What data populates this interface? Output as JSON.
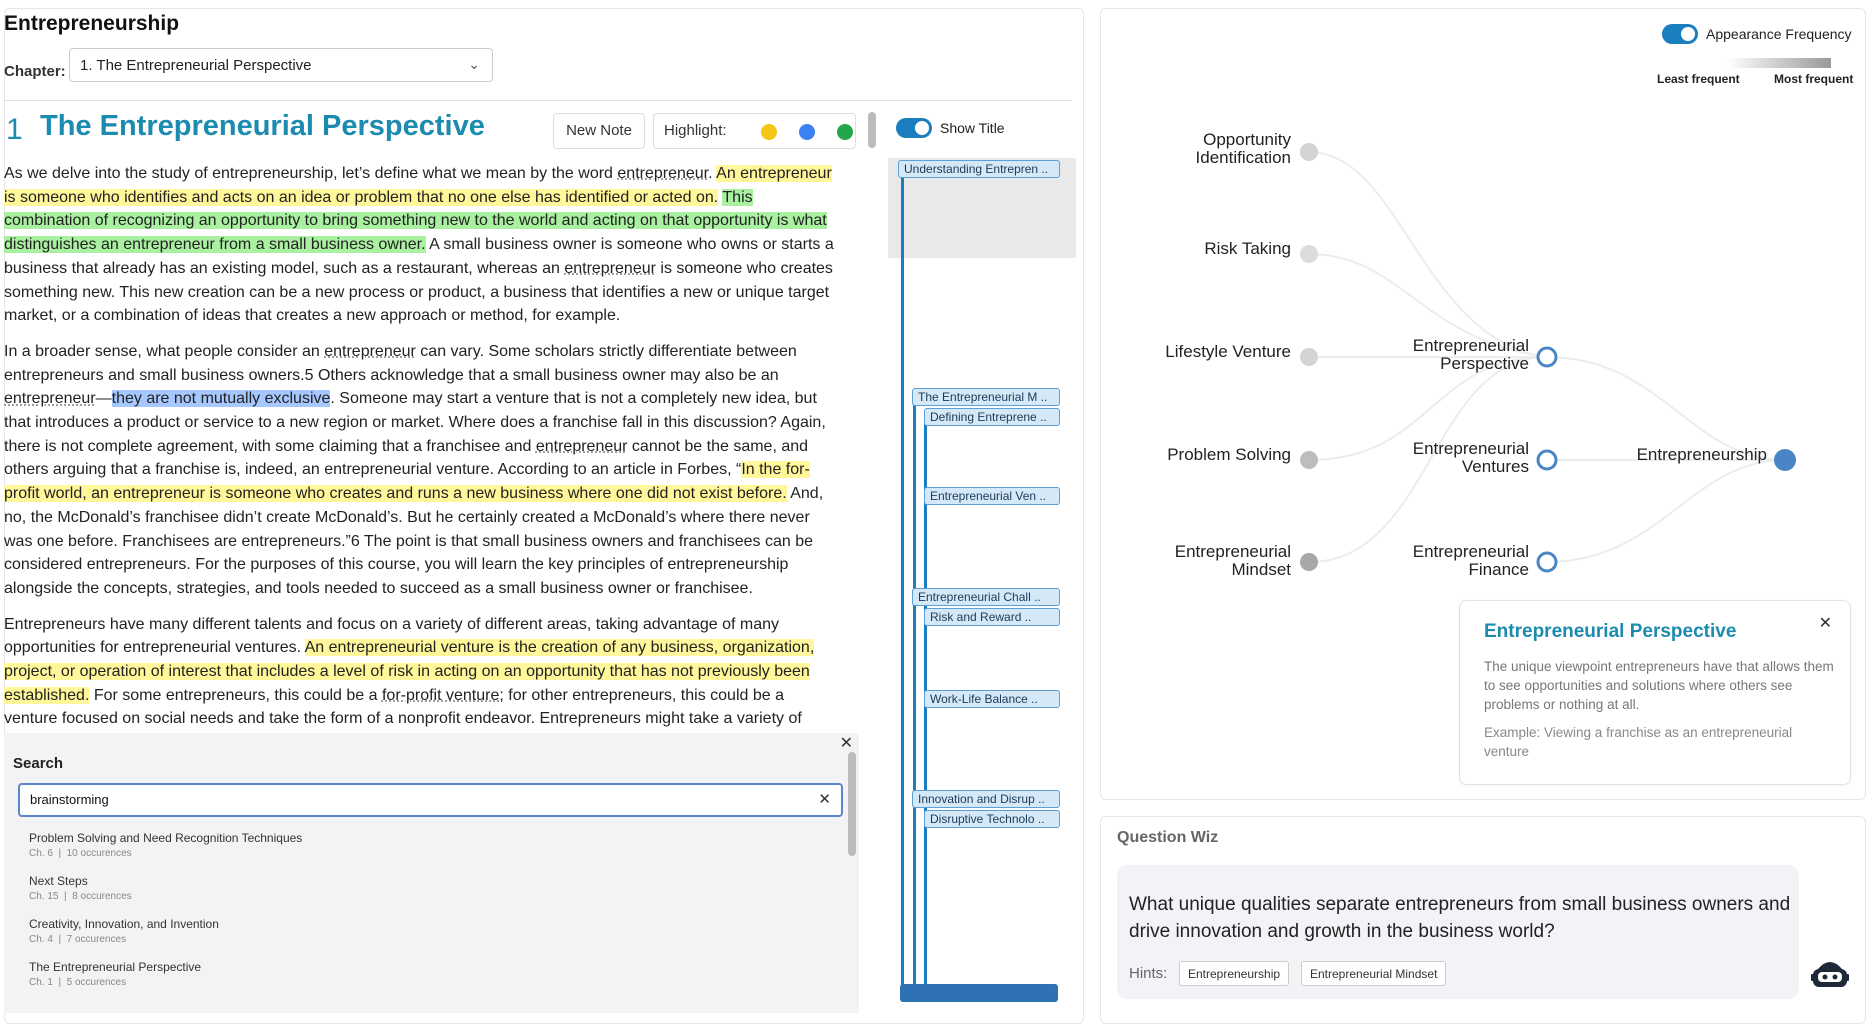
{
  "app": {
    "title": "Entrepreneurship"
  },
  "chapter": {
    "label": "Chapter:",
    "selected": "1. The Entrepreneurial Perspective"
  },
  "section": {
    "number": "1",
    "title": "The Entrepreneurial Perspective"
  },
  "toolbar": {
    "new_note": "New Note",
    "highlight_label": "Highlight:",
    "highlight_colors": [
      "#f5c518",
      "#3b82f6",
      "#22a84a"
    ]
  },
  "text": {
    "p1": [
      {
        "t": "As we delve into the study of entrepreneurship, let’s define what we mean by the word ",
        "c": ""
      },
      {
        "t": "entrepreneur",
        "c": "u"
      },
      {
        "t": ". ",
        "c": ""
      },
      {
        "t": "An ",
        "c": "y"
      },
      {
        "t": "entrepreneur is someone who identifies and acts on an idea or problem that no one else has identified or acted on.",
        "c": "y"
      },
      {
        "t": " ",
        "c": ""
      },
      {
        "t": "This combination of recognizing an opportunity to bring something new to the world and acting on that opportunity is what distinguishes an entrepreneur from a small business owner.",
        "c": "g"
      },
      {
        "t": " A small business owner is someone who owns or starts a business that already has an existing model, such as a restaurant, whereas an ",
        "c": ""
      },
      {
        "t": "entrepreneur",
        "c": "u"
      },
      {
        "t": " is someone who creates something new. This new creation can be a new process or product, a business that identifies a new or unique target market, or a combination of ideas that creates a new approach or method, for example.",
        "c": ""
      }
    ],
    "p2": [
      {
        "t": "In a broader sense, what people consider an ",
        "c": ""
      },
      {
        "t": "entrepreneur",
        "c": "u"
      },
      {
        "t": " can vary. Some scholars strictly differentiate between entrepreneurs and small business owners.5 Others acknowledge that a small business owner may also be an ",
        "c": ""
      },
      {
        "t": "entrepreneur",
        "c": "u"
      },
      {
        "t": "—",
        "c": ""
      },
      {
        "t": "they are not mutually exclusive",
        "c": "b"
      },
      {
        "t": ". Someone may start a venture that is not a completely new idea, but that introduces a product or service to a new region or market. Where does a franchise fall in this discussion? Again, there is not complete agreement, with some claiming that a franchisee and ",
        "c": ""
      },
      {
        "t": "entrepreneur",
        "c": "u"
      },
      {
        "t": " cannot be the same, and others arguing that a franchise is, indeed, an entrepreneurial venture. According to an article in Forbes, “",
        "c": ""
      },
      {
        "t": "In the for-profit world, an entrepreneur is someone who creates and runs a new business where one did not exist before.",
        "c": "y"
      },
      {
        "t": " And, no, the McDonald’s franchisee didn’t create McDonald’s. But he certainly created a McDonald’s where there never was one before. Franchisees are entrepreneurs.”6 The point is that small business owners and franchisees can be considered entrepreneurs. For the purposes of this course, you will learn the key principles of entrepreneurship alongside the concepts, strategies, and tools needed to succeed as a small business owner or franchisee.",
        "c": ""
      }
    ],
    "p3": [
      {
        "t": "Entrepreneurs have many different talents and focus on a variety of different areas, taking advantage of many opportunities for entrepreneurial ventures. ",
        "c": ""
      },
      {
        "t": "An entrepreneurial venture is the creation of any business, organization, project, or operation of interest that includes a level of risk in acting on an opportunity that has not previously been established.",
        "c": "y"
      },
      {
        "t": " For some entrepreneurs, this could be a ",
        "c": ""
      },
      {
        "t": "for-profit venture",
        "c": "u"
      },
      {
        "t": "; for other entrepreneurs, this could be a venture focused on social needs and take the form of a nonprofit endeavor. Entrepreneurs might take a variety of approaches to their ventures, from small local businesses to large global organizations.",
        "c": ""
      }
    ]
  },
  "search": {
    "label": "Search",
    "query": "brainstorming",
    "results": [
      {
        "title": "Problem Solving and Need Recognition Techniques",
        "chapter": "Ch. 6",
        "count": "10 occurences"
      },
      {
        "title": "Next Steps",
        "chapter": "Ch. 15",
        "count": "8 occurences"
      },
      {
        "title": "Creativity, Innovation, and Invention",
        "chapter": "Ch. 4",
        "count": "7 occurences"
      },
      {
        "title": "The Entrepreneurial Perspective",
        "chapter": "Ch. 1",
        "count": "5 occurences"
      }
    ]
  },
  "timeline": {
    "show_title_label": "Show Title",
    "items": [
      "Understanding Entrepren ..",
      "The Entrepreneurial M ..",
      "Defining Entreprene ..",
      "Entrepreneurial Ven ..",
      "Entrepreneurial Chall ..",
      "Risk and Reward ..",
      "Work-Life Balance ..",
      "Innovation and Disrup ..",
      "Disruptive Technolo .."
    ]
  },
  "graph": {
    "toggle_label": "Appearance Frequency",
    "legend_least": "Least frequent",
    "legend_most": "Most frequent",
    "nodes": {
      "opportunity": [
        "Opportunity",
        "Identification"
      ],
      "risk": [
        "Risk Taking"
      ],
      "lifestyle": [
        "Lifestyle Venture"
      ],
      "problem": [
        "Problem Solving"
      ],
      "mindset": [
        "Entrepreneurial",
        "Mindset"
      ],
      "perspective": [
        "Entrepreneurial",
        "Perspective"
      ],
      "ventures": [
        "Entrepreneurial",
        "Ventures"
      ],
      "finance": [
        "Entrepreneurial",
        "Finance"
      ],
      "root": [
        "Entrepreneurship"
      ]
    },
    "colors": {
      "accent": "#1b7fbf",
      "root": "#4a86c5",
      "leaf_light": "#d4d4d4",
      "leaf_dark": "#a8a8a8"
    }
  },
  "definition": {
    "title": "Entrepreneurial Perspective",
    "body": "The unique viewpoint entrepreneurs have that allows them to see opportunities and solutions where others see problems or nothing at all.",
    "example": "Example: Viewing a franchise as an entrepreneurial venture"
  },
  "question_wiz": {
    "title": "Question Wiz",
    "question": "What unique qualities separate entrepreneurs from small business owners and drive innovation and growth in the business world?",
    "hints_label": "Hints:",
    "hints": [
      "Entrepreneurship",
      "Entrepreneurial Mindset"
    ]
  }
}
